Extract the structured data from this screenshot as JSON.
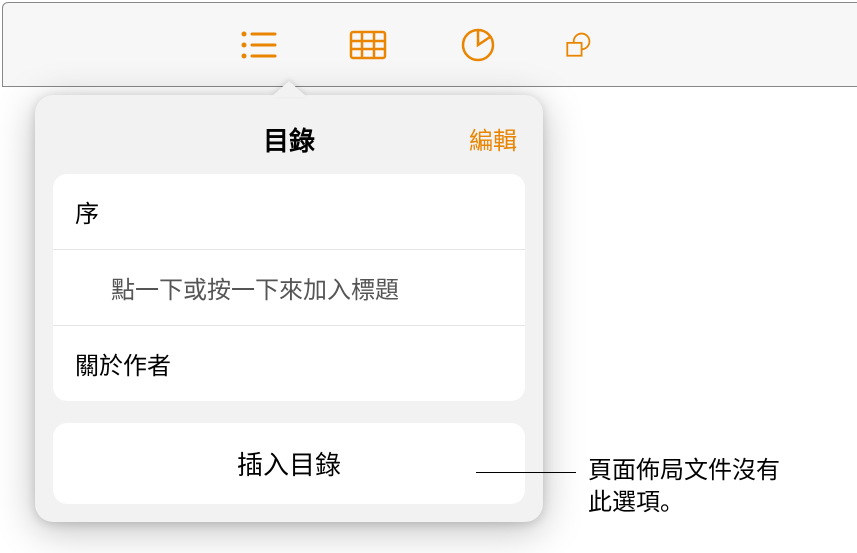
{
  "colors": {
    "accent": "#e98500"
  },
  "toolbar": {
    "icons": [
      "list-icon",
      "table-icon",
      "chart-icon",
      "shape-icon"
    ]
  },
  "popover": {
    "title": "目錄",
    "edit_label": "編輯",
    "items": [
      {
        "label": "序",
        "indent": 0
      },
      {
        "label": "點一下或按一下來加入標題",
        "indent": 1
      },
      {
        "label": "關於作者",
        "indent": 0
      }
    ],
    "insert_label": "插入目錄"
  },
  "callout": {
    "line1": "頁面佈局文件沒有",
    "line2": "此選項。"
  }
}
